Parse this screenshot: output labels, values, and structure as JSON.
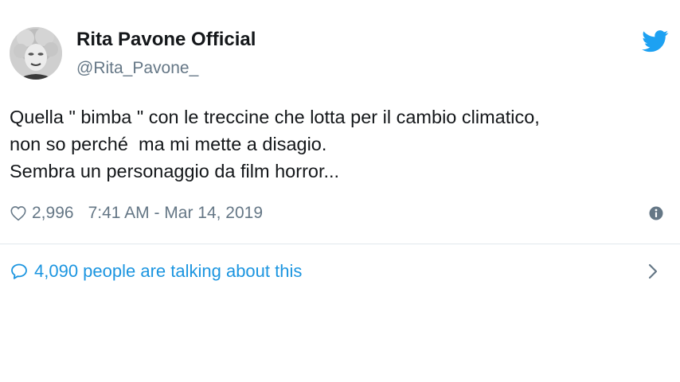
{
  "author": {
    "display_name": "Rita Pavone Official",
    "handle": "@Rita_Pavone_",
    "avatar_icon": "profile-photo"
  },
  "brand": {
    "icon": "twitter-bird-icon",
    "color": "#1da1f2"
  },
  "tweet": {
    "text_lines": [
      "Quella \" bimba \" con le treccine che lotta per il cambio climatico,",
      "non so perché  ma mi mette a disagio.",
      "Sembra un personaggio da film horror..."
    ]
  },
  "meta": {
    "likes": "2,996",
    "timestamp": "7:41 AM - Mar 14, 2019",
    "like_icon": "heart-icon",
    "info_icon": "info-icon"
  },
  "footer": {
    "talking_text": "4,090 people are talking about this",
    "talking_icon": "speech-bubble-icon",
    "chevron_icon": "chevron-right-icon",
    "link_color": "#1b95e0"
  },
  "colors": {
    "text": "#14171a",
    "secondary": "#657786",
    "divider": "#e1e8ed"
  }
}
